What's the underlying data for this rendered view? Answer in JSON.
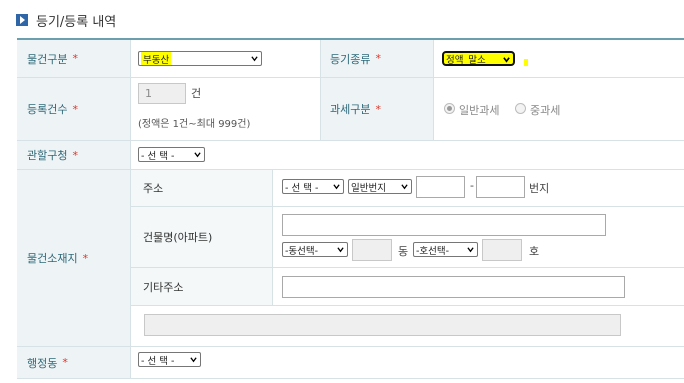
{
  "section": {
    "title": "등기/등록 내역",
    "icon": "arrow-box-icon"
  },
  "fields": {
    "property_type": {
      "label": "물건구분",
      "value": "부동산"
    },
    "registration_type": {
      "label": "등기종류",
      "value": "정액_말소"
    },
    "registration_count": {
      "label": "등록건수",
      "value": "1",
      "unit": "건",
      "hint": "(정액은 1건~최대 999건)"
    },
    "tax_class": {
      "label": "과세구분",
      "options": [
        "일반과세",
        "중과세"
      ]
    },
    "jurisdiction": {
      "label": "관할구청",
      "value": "- 선 택 -"
    },
    "location": {
      "label": "물건소재지",
      "address": {
        "label": "주소",
        "select1": "- 선 택 -",
        "select2": "일반번지",
        "dash": "-",
        "unit": "번지"
      },
      "building": {
        "label": "건물명(아파트)",
        "dong_select": "-동선택-",
        "dong_unit": "동",
        "ho_select": "-호선택-",
        "ho_unit": "호"
      },
      "other": {
        "label": "기타주소"
      }
    },
    "admin_dong": {
      "label": "행정동",
      "value": "- 선 택 -"
    }
  },
  "required_mark": "*"
}
